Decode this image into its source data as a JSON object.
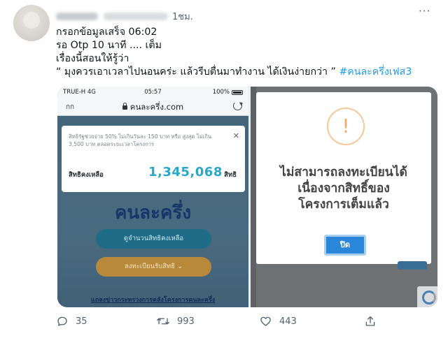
{
  "tweet": {
    "time": "1ชม.",
    "more_glyph": "···",
    "lines": [
      "กรอกข้อมูลเสร็จ 06:02",
      "รอ Otp 10 นาที   .... เต็ม",
      "เรื่องนี้สอนให้รู้ว่า",
      "“ มุงควรเอาเวลาไปนอนคร่ะ แล้วรีบตื่นมาทำงาน ได้เงินง่ายกว่า ”"
    ],
    "hashtag": "#คนละครึ่งเฟส3"
  },
  "phone": {
    "carrier": "TRUE-H  4G",
    "clock": "05:57",
    "battery": "100%",
    "url_left": "กก",
    "url": "คนละครึ่ง.com",
    "quota_note": "สิทธิรัฐช่วยจ่าย 50% ไม่เกินวันละ 150 บาท หรือ สูงสุด ไม่เกิน 3,500 บาท ตลอดระยะเวลาโครงการ",
    "close_glyph": "✕",
    "quota_label": "สิทธิคงเหลือ",
    "quota_value": "1,345,068",
    "quota_unit": "สิทธิ",
    "brand": "คนละครึ่ง",
    "btn_check": "ดูจำนวนสิทธิคงเหลือ",
    "btn_register": "ลงทะเบียนรับสิทธิ ⌄",
    "news_link": "แถลงข่าวกระทรวงการคลังโครงการคนละครึ่ง"
  },
  "modal": {
    "icon_glyph": "!",
    "message_lines": [
      "ไม่สามารถลงทะเบียนได้",
      "เนื่องจากสิทธิ์ของ",
      "โครงการเต็มแล้ว"
    ],
    "close_button": "ปิด"
  },
  "actions": {
    "replies": "35",
    "retweets": "993",
    "likes": "443"
  },
  "colors": {
    "accent": "#1d9bf0",
    "quota_value": "#2aa7c9",
    "modal_button": "#2a86d8",
    "warning": "#f0ab6b"
  }
}
